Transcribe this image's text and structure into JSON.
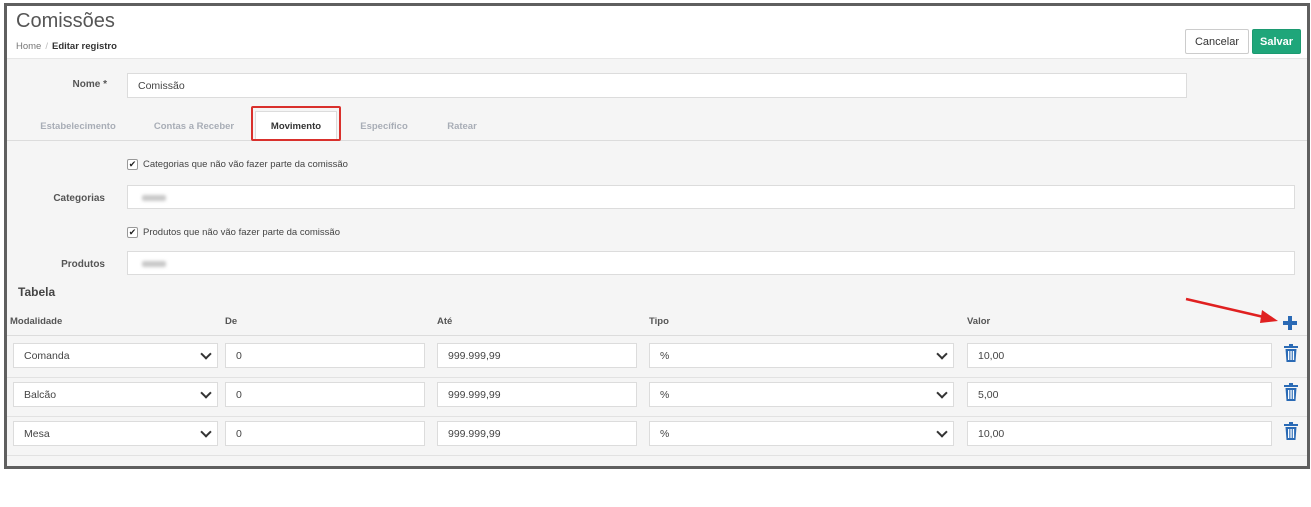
{
  "header": {
    "title": "Comissões",
    "breadcrumb": [
      "Home",
      "Editar registro"
    ],
    "cancel_label": "Cancelar",
    "save_label": "Salvar"
  },
  "form": {
    "nome_label": "Nome *",
    "nome_value": "Comissão",
    "categorias_label": "Categorias",
    "produtos_label": "Produtos",
    "categorias_checkbox": {
      "label": "Categorias que não vão fazer parte da comissão",
      "checked": true
    },
    "produtos_checkbox": {
      "label": "Produtos que não vão fazer parte da comissão",
      "checked": true
    }
  },
  "tabs": [
    {
      "label": "Estabelecimento",
      "active": false
    },
    {
      "label": "Contas a Receber",
      "active": false
    },
    {
      "label": "Movimento",
      "active": true
    },
    {
      "label": "Específico",
      "active": false
    },
    {
      "label": "Ratear",
      "active": false
    }
  ],
  "tabela": {
    "title": "Tabela",
    "columns": [
      "Modalidade",
      "De",
      "Até",
      "Tipo",
      "Valor"
    ],
    "rows": [
      {
        "modalidade": "Comanda",
        "de": "0",
        "ate": "999.999,99",
        "tipo": "%",
        "valor": "10,00"
      },
      {
        "modalidade": "Balcão",
        "de": "0",
        "ate": "999.999,99",
        "tipo": "%",
        "valor": "5,00"
      },
      {
        "modalidade": "Mesa",
        "de": "0",
        "ate": "999.999,99",
        "tipo": "%",
        "valor": "10,00"
      }
    ]
  },
  "colors": {
    "save": "#1fa67a",
    "accent_icon": "#2a6ab5",
    "annotation": "#e02020"
  },
  "icons": {
    "add": "plus-icon",
    "delete": "trash-icon",
    "select": "chevron-down-icon",
    "check": "checkmark-icon"
  }
}
